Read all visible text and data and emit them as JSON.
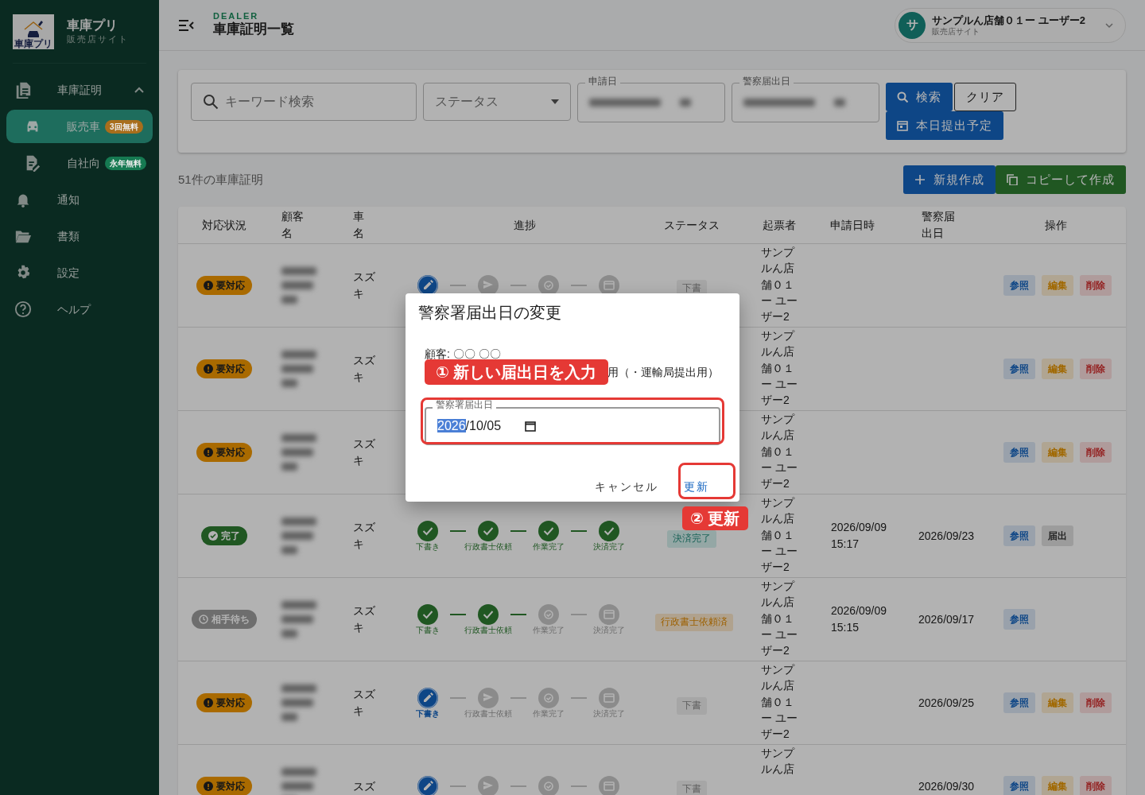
{
  "sidebar": {
    "logo_text": "車庫プリ",
    "app_name": "車庫プリ",
    "app_subtitle": "販売店サイト",
    "items": [
      {
        "label": "車庫証明",
        "expanded": true,
        "children": [
          {
            "label": "販売車",
            "badge": "3回無料",
            "color": "#a86e1c",
            "selected": true
          },
          {
            "label": "自社向",
            "badge": "永年無料",
            "color": "#167a52",
            "selected": false
          }
        ]
      },
      {
        "label": "通知"
      },
      {
        "label": "書類"
      },
      {
        "label": "設定"
      },
      {
        "label": "ヘルプ"
      }
    ]
  },
  "header": {
    "eyebrow": "DEALER",
    "title": "車庫証明一覧",
    "user": {
      "avatar": "サ",
      "name": "サンプルん店舗０１ー ユーザー2",
      "role": "販売店サイト"
    }
  },
  "filters": {
    "search": {
      "placeholder": "キーワード検索"
    },
    "status": {
      "placeholder": "ステータス"
    },
    "dates": [
      {
        "label": "申請日"
      },
      {
        "label": "警察届出日"
      }
    ],
    "buttons": [
      {
        "label": "検索",
        "kind": "search"
      },
      {
        "label": "クリア",
        "kind": "clear"
      },
      {
        "label": "本日提出予定",
        "kind": "today"
      }
    ]
  },
  "count": "51件の車庫証明",
  "actions": [
    {
      "label": "新規作成",
      "kind": "new"
    },
    {
      "label": "コピーして作成",
      "kind": "copy"
    }
  ],
  "table": {
    "columns": [
      "対応状況",
      "顧客名",
      "車名",
      "進捗",
      "ステータス",
      "起票者",
      "申請日時",
      "警察届出日",
      "操作"
    ],
    "rows": [
      {
        "attention": {
          "label": "要対応",
          "kind": "action"
        },
        "car": "スズキ",
        "progress": [
          {
            "kind": "current"
          },
          {
            "kind": "todo"
          },
          {
            "kind": "todo"
          },
          {
            "kind": "todo"
          }
        ],
        "status": {
          "label": "下書",
          "kind": "draft"
        },
        "issuer": "サンプルん店舗０１ー ユーザー2",
        "buttons": [
          {
            "label": "参照",
            "kind": "view"
          },
          {
            "label": "編集",
            "kind": "edit"
          },
          {
            "label": "削除",
            "kind": "delete"
          }
        ]
      },
      {
        "attention": {
          "label": "要対応",
          "kind": "action"
        },
        "car": "スズキ",
        "issuer": "サンプルん店舗０１ー ユーザー2",
        "buttons": [
          {
            "label": "参照",
            "kind": "view"
          },
          {
            "label": "編集",
            "kind": "edit"
          },
          {
            "label": "削除",
            "kind": "delete"
          }
        ]
      },
      {
        "attention": {
          "label": "要対応",
          "kind": "action"
        },
        "car": "スズキ",
        "issuer": "サンプルん店舗０１ー ユーザー2",
        "buttons": [
          {
            "label": "参照",
            "kind": "view"
          },
          {
            "label": "編集",
            "kind": "edit"
          },
          {
            "label": "削除",
            "kind": "delete"
          }
        ]
      },
      {
        "attention": {
          "label": "完了",
          "kind": "done"
        },
        "car": "スズキ",
        "progress": [
          {
            "label": "下書き",
            "kind": "done"
          },
          {
            "label": "行政書士依頼",
            "kind": "done"
          },
          {
            "label": "作業完了",
            "kind": "done"
          },
          {
            "label": "決済完了",
            "kind": "done"
          }
        ],
        "status": {
          "label": "決済完了",
          "kind": "paid"
        },
        "issuer": "サンプルん店舗０１ー ユーザー2",
        "applied_at": "2026/09/09 15:17",
        "police_date": "2026/09/23",
        "buttons": [
          {
            "label": "参照",
            "kind": "view"
          },
          {
            "label": "届出",
            "kind": "submit"
          }
        ]
      },
      {
        "attention": {
          "label": "相手待ち",
          "kind": "waiting"
        },
        "car": "スズキ",
        "progress": [
          {
            "label": "下書き",
            "kind": "done"
          },
          {
            "label": "行政書士依頼",
            "kind": "done"
          },
          {
            "label": "作業完了",
            "kind": "todo"
          },
          {
            "label": "決済完了",
            "kind": "todo"
          }
        ],
        "status": {
          "label": "行政書士依頼済",
          "kind": "requested"
        },
        "issuer": "サンプルん店舗０１ー ユーザー2",
        "applied_at": "2026/09/09 15:15",
        "police_date": "2026/09/17",
        "buttons": [
          {
            "label": "参照",
            "kind": "view"
          }
        ]
      },
      {
        "attention": {
          "label": "要対応",
          "kind": "action"
        },
        "car": "スズキ",
        "progress": [
          {
            "label": "下書き",
            "kind": "current"
          },
          {
            "label": "行政書士依頼",
            "kind": "todo"
          },
          {
            "label": "作業完了",
            "kind": "todo"
          },
          {
            "label": "決済完了",
            "kind": "todo"
          }
        ],
        "status": {
          "label": "下書",
          "kind": "draft"
        },
        "issuer": "サンプルん店舗０１ー ユーザー2",
        "police_date": "2026/09/25",
        "buttons": [
          {
            "label": "参照",
            "kind": "view"
          },
          {
            "label": "編集",
            "kind": "edit"
          },
          {
            "label": "削除",
            "kind": "delete"
          }
        ]
      },
      {
        "attention": {
          "label": "要対応",
          "kind": "action"
        },
        "car": "スズ",
        "progress": [
          {
            "kind": "current"
          },
          {
            "kind": "todo"
          },
          {
            "kind": "todo"
          },
          {
            "kind": "todo"
          }
        ],
        "status": {
          "label": "下書",
          "kind": "draft"
        },
        "issuer": "サンプルん店",
        "police_date": "2026/09/30",
        "buttons": [
          {
            "label": "参照",
            "kind": "view"
          },
          {
            "label": "編集",
            "kind": "edit"
          },
          {
            "label": "削除",
            "kind": "delete"
          }
        ]
      }
    ]
  },
  "dialog": {
    "title": "警察署届出日の変更",
    "customer": "顧客: 〇〇 〇〇",
    "note": "用（・運輸局提出用）",
    "field": {
      "label": "警察署届出日",
      "value_selected": "2026",
      "value_rest": "/10/05"
    },
    "buttons": [
      {
        "label": "キャンセル",
        "kind": "cancel"
      },
      {
        "label": "更新",
        "kind": "confirm"
      }
    ]
  },
  "annotations": [
    {
      "label": "① 新しい届出日を入力",
      "kind": "field"
    },
    {
      "label": "② 更新",
      "kind": "button"
    }
  ]
}
